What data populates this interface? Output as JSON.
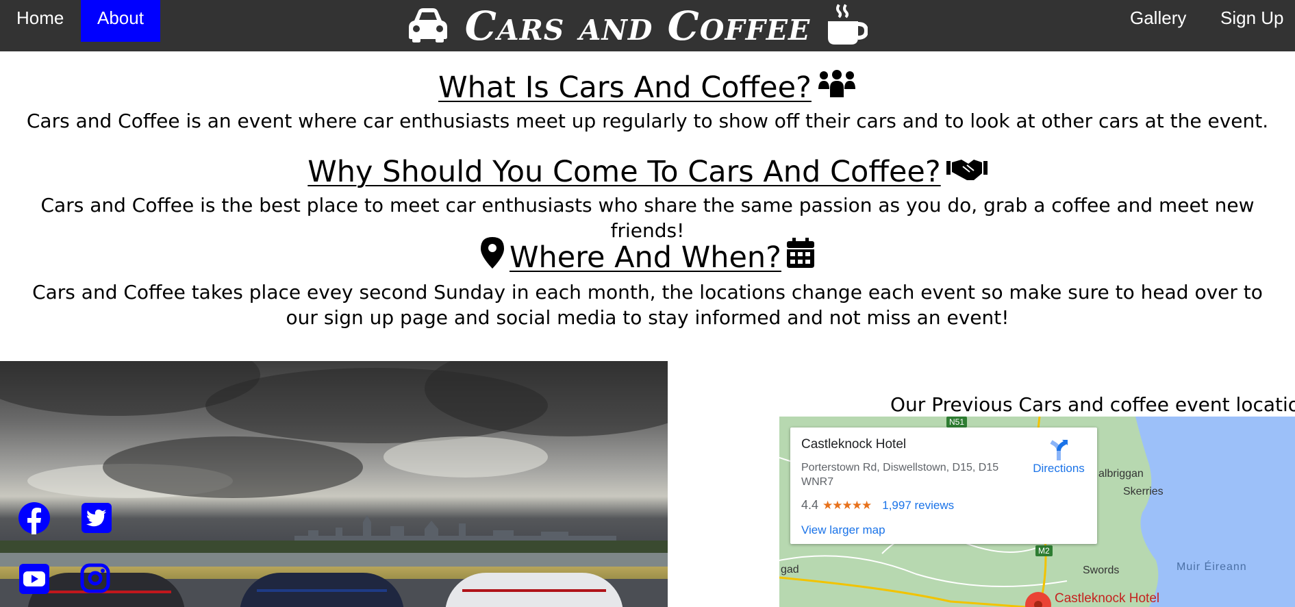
{
  "nav": {
    "home": "Home",
    "about": "About",
    "gallery": "Gallery",
    "signup": "Sign Up",
    "brand": "Cars and Coffee",
    "brand_left_icon": "car-icon",
    "brand_right_icon": "coffee-cup-icon"
  },
  "sections": [
    {
      "heading": "What Is Cars And Coffee?",
      "icon": "people-group-icon",
      "text": "Cars and Coffee is an event where car enthusiasts meet up regularly to show off their cars and to look at other cars at the event."
    },
    {
      "heading": "Why Should You Come To Cars And Coffee?",
      "icon": "handshake-icon",
      "text": "Cars and Coffee is the best place to meet car enthusiasts who share the same passion as you do, grab a coffee and meet new friends!"
    },
    {
      "heading": "Where And When?",
      "icon_left": "map-pin-icon",
      "icon_right": "calendar-icon",
      "text": "Cars and Coffee takes place evey second Sunday in each month, the locations change each event so make sure to head over to our sign up page and social media to stay informed and not miss an event!"
    }
  ],
  "social": [
    "facebook-icon",
    "twitter-icon",
    "youtube-icon",
    "instagram-icon"
  ],
  "map": {
    "caption": "Our Previous Cars and coffee event location",
    "place_name": "Castleknock Hotel",
    "address": "Porterstown Rd, Diswellstown, D15, D15 WNR7",
    "rating": "4.4",
    "stars": "★★★★★",
    "reviews": "1,997 reviews",
    "directions": "Directions",
    "view_larger": "View larger map",
    "labels": {
      "balbriggan": "albriggan",
      "skerries": "Skerries",
      "swords": "Swords",
      "sea": "Muir Éireann",
      "pin": "Castleknock Hotel",
      "left": "gad",
      "n51": "N51",
      "m2": "M2"
    }
  },
  "colors": {
    "navbar": "#333333",
    "active": "#0000ff",
    "social": "#0000ff",
    "map_link": "#1a73e8"
  }
}
